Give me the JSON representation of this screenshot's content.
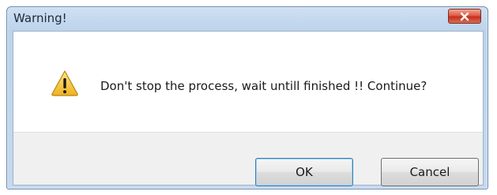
{
  "window": {
    "title": "Warning!"
  },
  "dialog": {
    "icon": "warning-triangle-icon",
    "message": "Don't stop the process, wait untill finished !! Continue?"
  },
  "buttons": {
    "ok_label": "OK",
    "cancel_label": "Cancel"
  },
  "colors": {
    "title_bar": "#bcd3ea",
    "close_button": "#c6301e",
    "warning_yellow": "#f6c533",
    "button_bar": "#f0f0f0"
  }
}
